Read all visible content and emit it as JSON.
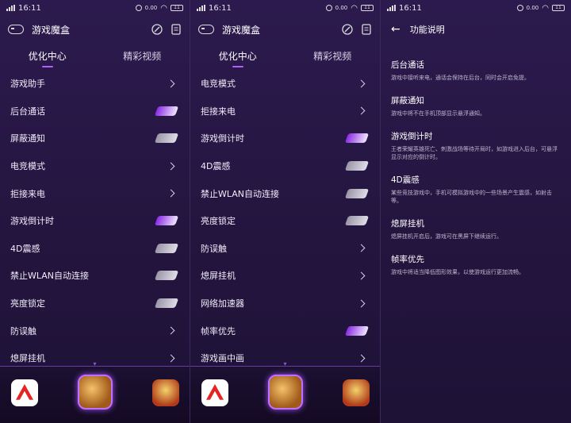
{
  "status_bar": {
    "time": "16:11",
    "battery": "11",
    "speed": "0.00"
  },
  "screen1": {
    "app_title": "游戏魔盒",
    "tabs": [
      "优化中心",
      "精彩视频"
    ],
    "rows": [
      {
        "label": "游戏助手",
        "control": "chevron"
      },
      {
        "label": "后台通话",
        "control": "toggle-on"
      },
      {
        "label": "屏蔽通知",
        "control": "toggle-off"
      },
      {
        "label": "电竞模式",
        "control": "chevron"
      },
      {
        "label": "拒接来电",
        "control": "chevron"
      },
      {
        "label": "游戏倒计时",
        "control": "toggle-on"
      },
      {
        "label": "4D震感",
        "control": "toggle-off"
      },
      {
        "label": "禁止WLAN自动连接",
        "control": "toggle-off"
      },
      {
        "label": "亮度锁定",
        "control": "toggle-off"
      },
      {
        "label": "防误触",
        "control": "chevron"
      },
      {
        "label": "熄屏挂机",
        "control": "chevron"
      }
    ]
  },
  "screen2": {
    "app_title": "游戏魔盒",
    "tabs": [
      "优化中心",
      "精彩视频"
    ],
    "rows": [
      {
        "label": "电竞模式",
        "control": "chevron"
      },
      {
        "label": "拒接来电",
        "control": "chevron"
      },
      {
        "label": "游戏倒计时",
        "control": "toggle-on"
      },
      {
        "label": "4D震感",
        "control": "toggle-off"
      },
      {
        "label": "禁止WLAN自动连接",
        "control": "toggle-off"
      },
      {
        "label": "亮度锁定",
        "control": "toggle-off"
      },
      {
        "label": "防误触",
        "control": "chevron"
      },
      {
        "label": "熄屏挂机",
        "control": "chevron"
      },
      {
        "label": "网络加速器",
        "control": "chevron"
      },
      {
        "label": "帧率优先",
        "control": "toggle-on"
      },
      {
        "label": "游戏画中画",
        "control": "chevron"
      }
    ]
  },
  "screen3": {
    "title": "功能说明",
    "sections": [
      {
        "heading": "后台通话",
        "text": "游戏中接听来电，通话会保持在后台，同时会开启免提。"
      },
      {
        "heading": "屏蔽通知",
        "text": "游戏中将不在手机顶部显示悬浮通知。"
      },
      {
        "heading": "游戏倒计时",
        "text": "王者荣耀英雄死亡、刺激战场等待开局时，如游戏进入后台，可悬浮显示对应的倒计时。"
      },
      {
        "heading": "4D震感",
        "text": "某些竞技游戏中，手机可模拟游戏中的一些场景产生震感，如射击等。"
      },
      {
        "heading": "熄屏挂机",
        "text": "熄屏挂机开启后，游戏可在黑屏下继续运行。"
      },
      {
        "heading": "帧率优先",
        "text": "游戏中将适当降低图形效果，以使游戏运行更加流畅。"
      }
    ]
  },
  "icons": [
    "signal-icon",
    "wifi-icon",
    "battery-icon",
    "game-controller-icon",
    "speed-icon",
    "document-icon",
    "chevron-right-icon",
    "back-arrow-icon"
  ],
  "colors": {
    "accent": "#b060ff",
    "background": "#2c1a4e",
    "toggle_on": "#8a2be2"
  }
}
